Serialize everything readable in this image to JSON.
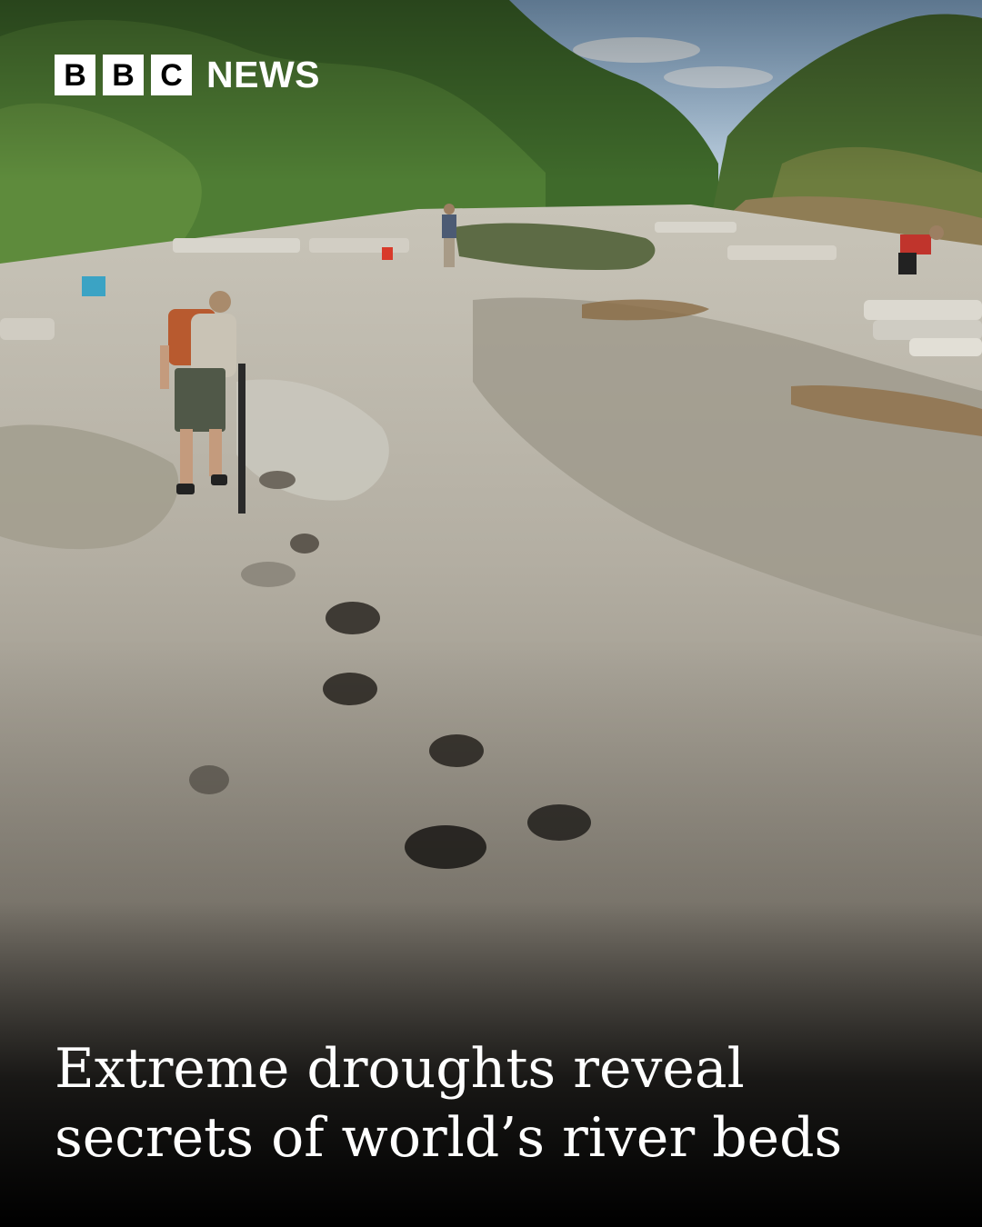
{
  "brand": {
    "letters": [
      "B",
      "B",
      "C"
    ],
    "word": "NEWS"
  },
  "headline": {
    "line1": "Extreme droughts reveal",
    "line2": "secrets of world’s river beds"
  },
  "colors": {
    "brand_box": "#ffffff",
    "brand_letter": "#000000",
    "headline_text": "#ffffff",
    "overlay": "#000000"
  },
  "icons": [
    "bbc-news-logo"
  ]
}
